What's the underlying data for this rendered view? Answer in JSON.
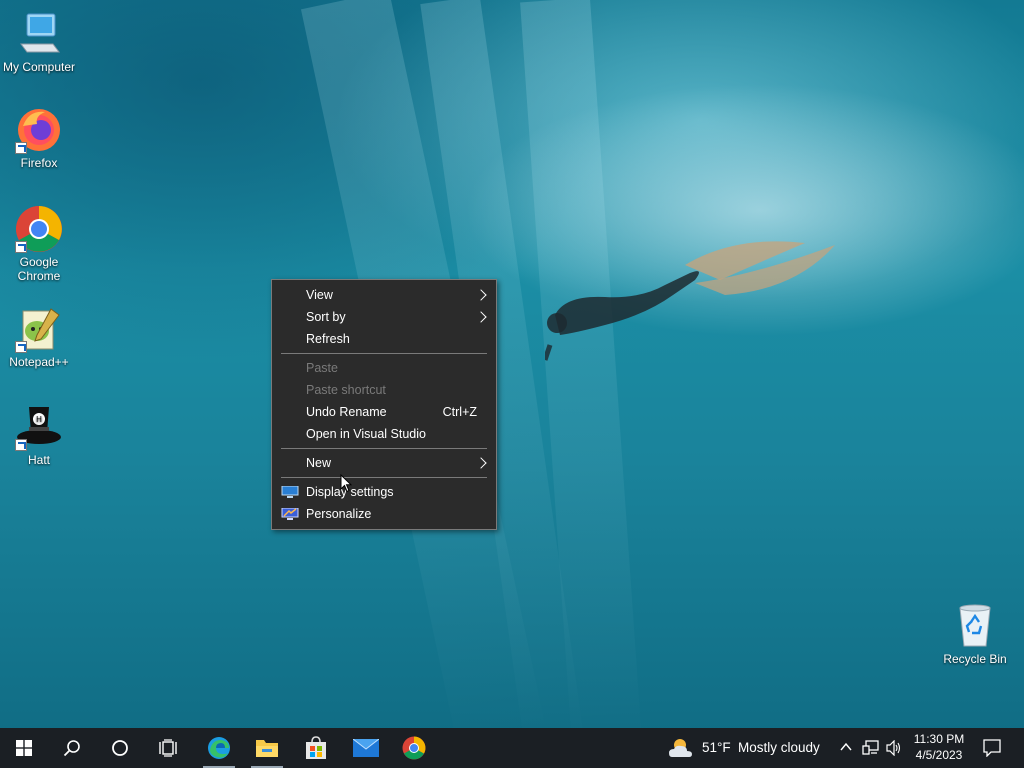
{
  "desktop": {
    "icons": [
      {
        "label": "My Computer",
        "icon": "computer-icon"
      },
      {
        "label": "Firefox",
        "icon": "firefox-icon"
      },
      {
        "label": "Google Chrome",
        "icon": "chrome-icon"
      },
      {
        "label": "Notepad++",
        "icon": "notepadpp-icon"
      },
      {
        "label": "Hatt",
        "icon": "hatt-icon"
      },
      {
        "label": "Recycle Bin",
        "icon": "recycle-bin-icon"
      }
    ]
  },
  "context_menu": {
    "items": [
      {
        "label": "View",
        "submenu": true,
        "enabled": true
      },
      {
        "label": "Sort by",
        "submenu": true,
        "enabled": true
      },
      {
        "label": "Refresh",
        "enabled": true
      },
      {
        "label": "Paste",
        "enabled": false
      },
      {
        "label": "Paste shortcut",
        "enabled": false
      },
      {
        "label": "Undo Rename",
        "shortcut": "Ctrl+Z",
        "enabled": true
      },
      {
        "label": "Open in Visual Studio",
        "enabled": true
      },
      {
        "label": "New",
        "submenu": true,
        "enabled": true
      },
      {
        "label": "Display settings",
        "icon": "display-icon",
        "enabled": true
      },
      {
        "label": "Personalize",
        "icon": "personalize-icon",
        "enabled": true
      }
    ]
  },
  "taskbar": {
    "apps": [
      "start-icon",
      "search-icon",
      "cortana-icon",
      "task-view-icon",
      "edge-icon",
      "file-explorer-icon",
      "store-icon",
      "mail-icon",
      "chrome-icon"
    ],
    "weather": {
      "temp": "51°F",
      "condition": "Mostly cloudy"
    },
    "clock": {
      "time": "11:30 PM",
      "date": "4/5/2023"
    }
  },
  "colors": {
    "taskbar": "#1b1f24",
    "menu_bg": "#2b2b2b",
    "accent": "#0078d4"
  }
}
